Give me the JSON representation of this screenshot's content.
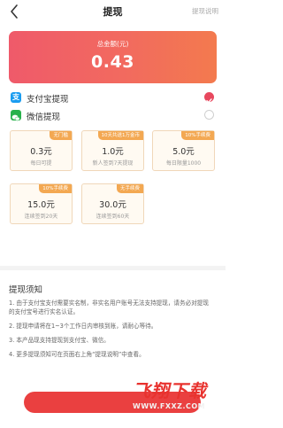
{
  "header": {
    "title": "提现",
    "help_link": "提现说明"
  },
  "balance": {
    "label": "总金额(元)",
    "amount": "0.43",
    "gradient_start": "#ef5a6a",
    "gradient_end": "#f37a4e"
  },
  "methods": [
    {
      "label": "支付宝提现",
      "icon": "alipay-icon",
      "icon_char": "支",
      "selected": true
    },
    {
      "label": "微信提现",
      "icon": "wechat-icon",
      "selected": false
    }
  ],
  "options": [
    {
      "tag": "无门槛",
      "amount": "0.3元",
      "desc": "每日可提"
    },
    {
      "tag": "10天共送1万金币",
      "amount": "1.0元",
      "desc": "新人签到7天提现"
    },
    {
      "tag": "10%手续费",
      "amount": "5.0元",
      "desc": "每日限量1000"
    },
    {
      "tag": "10%手续费",
      "amount": "15.0元",
      "desc": "连续签到20天"
    },
    {
      "tag": "无手续费",
      "amount": "30.0元",
      "desc": "连续签到60天"
    }
  ],
  "notes": {
    "title": "提现须知",
    "items": [
      "1. 由于支付宝支付需要实名制，非实名用户账号无法支持提现，请务必对提现的支付宝号进行实名认证。",
      "2. 提现申请将在1~3个工作日内审核到账，请耐心等待。",
      "3. 本产品现支持提现到支付宝、微信。",
      "4. 更多提现须知可在页面右上角“提现说明”中查看。"
    ]
  },
  "watermark": {
    "main_text": "飞翔下载",
    "url_text": "WWW.FXXZ.COM"
  },
  "colors": {
    "accent": "#e8485e",
    "tag_orange": "#f3a852",
    "card_border": "#f0d7b9",
    "submit": "#ea4040"
  }
}
